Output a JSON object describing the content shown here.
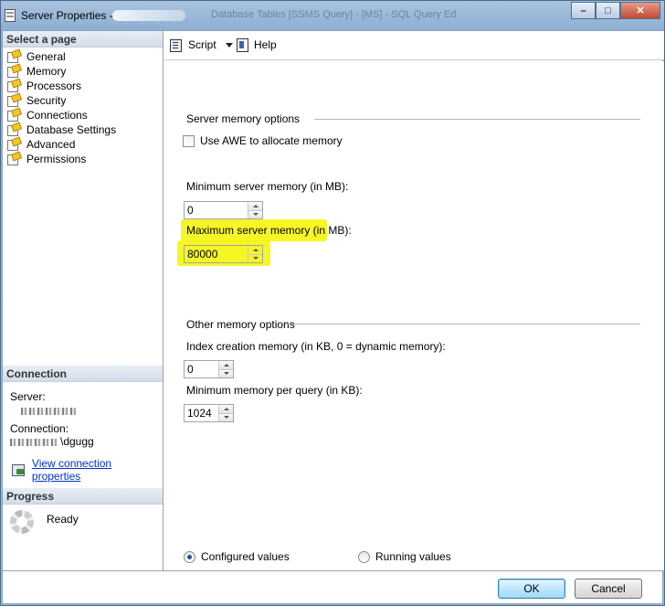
{
  "window": {
    "title": "Server Properties - ",
    "background_title": "Database Tables  [SSMS Query]  -  [MS] - SQL Query Ed"
  },
  "left": {
    "select_page_heading": "Select a page",
    "pages": [
      {
        "label": "General",
        "icon": "property-page-icon"
      },
      {
        "label": "Memory",
        "icon": "property-page-icon"
      },
      {
        "label": "Processors",
        "icon": "property-page-icon"
      },
      {
        "label": "Security",
        "icon": "property-page-icon"
      },
      {
        "label": "Connections",
        "icon": "property-page-icon"
      },
      {
        "label": "Database Settings",
        "icon": "property-page-icon"
      },
      {
        "label": "Advanced",
        "icon": "property-page-icon"
      },
      {
        "label": "Permissions",
        "icon": "property-page-icon"
      }
    ],
    "connection_heading": "Connection",
    "server_label": "Server:",
    "connection_label": "Connection:",
    "connection_value": "\\dgugg",
    "view_props_link": "View connection properties",
    "progress_heading": "Progress",
    "progress_status": "Ready"
  },
  "toolbar": {
    "script_label": "Script",
    "help_label": "Help"
  },
  "memory": {
    "server_memory_group": "Server memory options",
    "use_awe_label": "Use AWE to allocate memory",
    "use_awe_checked": false,
    "min_label": "Minimum server memory (in MB):",
    "min_value": "0",
    "max_label": "Maximum server memory (in MB):",
    "max_value": "80000",
    "other_group": "Other memory options",
    "index_label": "Index creation memory (in KB, 0 = dynamic memory):",
    "index_value": "0",
    "min_query_label": "Minimum memory per query (in KB):",
    "min_query_value": "1024",
    "configured_label": "Configured values",
    "running_label": "Running values",
    "selected_mode": "configured"
  },
  "buttons": {
    "ok": "OK",
    "cancel": "Cancel"
  },
  "colors": {
    "highlight": "#f5f500",
    "link": "#0033cc",
    "section_header": "#dbe4ef"
  }
}
